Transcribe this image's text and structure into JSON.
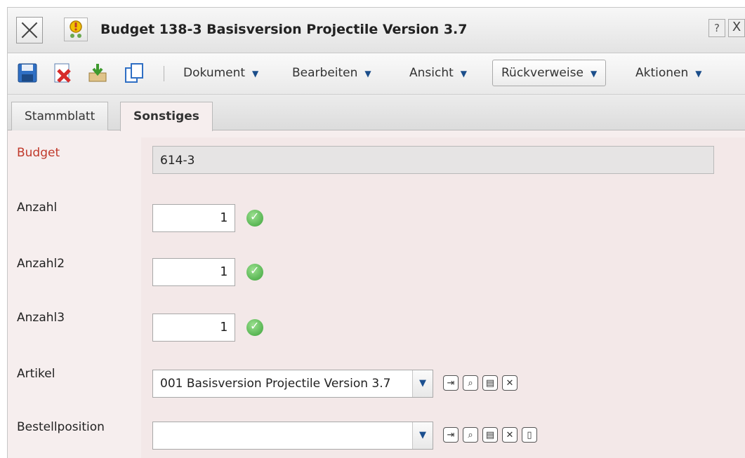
{
  "window": {
    "title": "Budget 138-3 Basisversion Projectile Version 3.7",
    "help_label": "?",
    "close_label": "X"
  },
  "toolbar": {
    "icons": [
      "save-icon",
      "delete-icon",
      "download-icon",
      "copy-icon"
    ],
    "menus": [
      {
        "label": "Dokument"
      },
      {
        "label": "Bearbeiten"
      },
      {
        "label": "Ansicht"
      },
      {
        "label": "Rückverweise"
      },
      {
        "label": "Aktionen"
      }
    ],
    "caret": "▼"
  },
  "tabs": [
    {
      "label": "Stammblatt",
      "active": false
    },
    {
      "label": "Sonstiges",
      "active": true
    }
  ],
  "form": {
    "budget": {
      "label": "Budget",
      "value": "614-3"
    },
    "anzahl": {
      "label": "Anzahl",
      "value": "1"
    },
    "anzahl2": {
      "label": "Anzahl2",
      "value": "1"
    },
    "anzahl3": {
      "label": "Anzahl3",
      "value": "1"
    },
    "artikel": {
      "label": "Artikel",
      "value": "001 Basisversion Projectile Version 3.7"
    },
    "bestellposition": {
      "label": "Bestellposition",
      "value": ""
    }
  },
  "colors": {
    "required_label": "#c0392b",
    "form_bg": "#f3e8e8"
  }
}
